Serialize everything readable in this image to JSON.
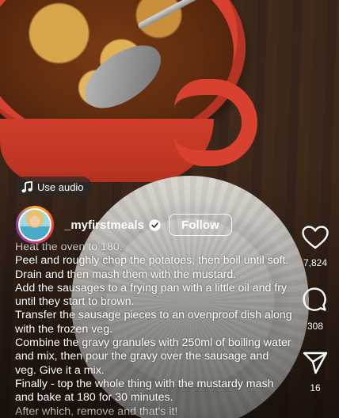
{
  "audio_chip": {
    "label": "Use audio",
    "icon": "music-note-icon"
  },
  "user": {
    "username": "_myfirstmeals",
    "verified": true,
    "follow_label": "Follow"
  },
  "caption": {
    "lines": [
      "Heat the oven to 180.",
      "Peel and roughly chop the potatoes, then boil until soft. Drain and then mash them with the mustard.",
      "Add the sausages to a frying pan with a little oil and fry until they start to brown.",
      "Transfer the sausage pieces to an ovenproof dish along with the frozen veg.",
      "Combine the gravy granules with 250ml of boiling water and mix, then pour the gravy over the sausage and veg. Give it a mix.",
      "Finally - top the whole thing with the mustardy mash and bake at 180 for 30 minutes.",
      "After which, remove and that's it!"
    ]
  },
  "actions": {
    "like": {
      "icon": "heart-icon",
      "count": "7,824"
    },
    "comment": {
      "icon": "comment-bubble-icon",
      "count": "308"
    },
    "share": {
      "icon": "send-arrow-icon",
      "count": "16"
    }
  }
}
